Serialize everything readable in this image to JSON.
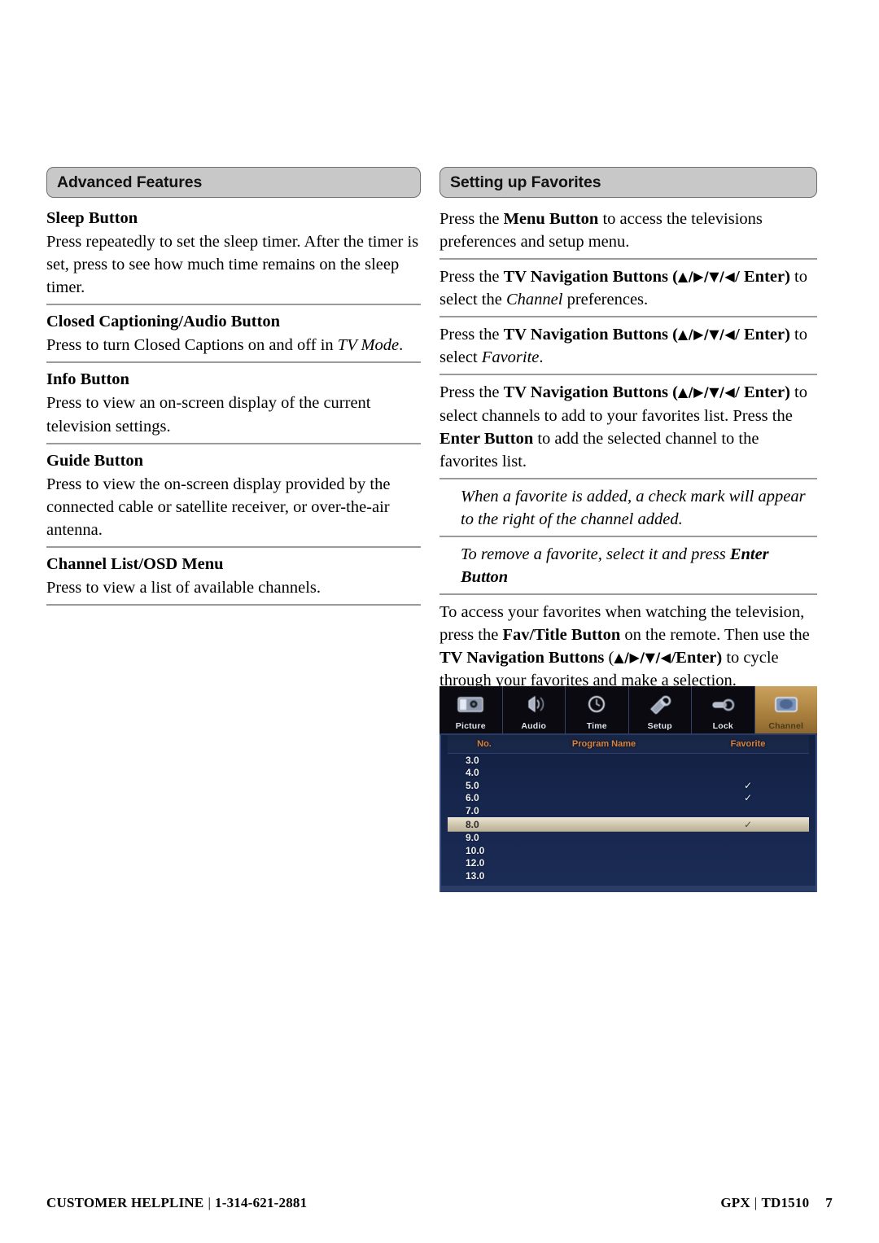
{
  "left_column": {
    "header": "Advanced Features",
    "blocks": [
      {
        "title": "Sleep Button",
        "body": "Press repeatedly to set the sleep timer. After the timer is set, press to see how much time remains on the sleep timer."
      },
      {
        "title": "Closed Captioning/Audio Button",
        "body_pre": "Press to turn Closed Captions on and off in ",
        "body_italic": "TV Mode",
        "body_post": "."
      },
      {
        "title": "Info Button",
        "body": "Press to view an on-screen display of the current television settings."
      },
      {
        "title": "Guide Button",
        "body": "Press to view the on-screen display provided by the connected cable or satellite receiver, or over-the-air antenna."
      },
      {
        "title": "Channel List/OSD Menu",
        "body": "Press to view a list of available channels."
      }
    ]
  },
  "right_column": {
    "header": "Setting up Favorites",
    "blocks": [
      {
        "seg1": "Press the ",
        "bold1": "Menu Button",
        "seg2": " to access the televisions preferences and setup menu."
      },
      {
        "seg1": "Press the ",
        "bold1": "TV Navigation Buttons (",
        "glyphs": "▲/▶/▼/◀",
        "bold2": "/ Enter)",
        "seg2": " to select the ",
        "italic1": "Channel",
        "seg3": " preferences."
      },
      {
        "seg1": "Press the ",
        "bold1": "TV Navigation Buttons (",
        "glyphs": "▲/▶/▼/◀",
        "bold2": "/ Enter)",
        "seg2": " to select ",
        "italic1": "Favorite",
        "seg3": "."
      },
      {
        "seg1": "Press the ",
        "bold1": "TV Navigation Buttons (",
        "glyphs": "▲/▶/▼/◀",
        "bold2": "/ Enter)",
        "seg2": " to select channels to add to your favorites list. Press the ",
        "bold3": "Enter Button",
        "seg3": " to add the selected channel to the favorites list."
      },
      {
        "italic_note": "When a favorite is added, a check mark will appear to the right of the channel added."
      },
      {
        "italic_pre": "To remove a favorite, select it and press ",
        "italic_bold": "Enter Button"
      },
      {
        "seg1": "To access your favorites when watching the television, press the ",
        "bold1": "Fav/Title Button",
        "seg2": " on the remote. Then use the ",
        "bold2": "TV Navigation Buttons",
        "seg3": " (",
        "glyphs": "▲/▶/▼/◀",
        "bold3": "/Enter)",
        "seg4": " to cycle through your favorites and make a selection."
      }
    ]
  },
  "tv_screenshot": {
    "menu_items": [
      {
        "label": "Picture",
        "icon": "picture-icon",
        "active": false
      },
      {
        "label": "Audio",
        "icon": "audio-icon",
        "active": false
      },
      {
        "label": "Time",
        "icon": "time-icon",
        "active": false
      },
      {
        "label": "Setup",
        "icon": "setup-icon",
        "active": false
      },
      {
        "label": "Lock",
        "icon": "lock-icon",
        "active": false
      },
      {
        "label": "Channel",
        "icon": "channel-icon",
        "active": true
      }
    ],
    "columns": [
      "No.",
      "Program Name",
      "Favorite"
    ],
    "rows": [
      {
        "no": "3.0",
        "name": "",
        "favorite": "",
        "selected": false
      },
      {
        "no": "4.0",
        "name": "",
        "favorite": "",
        "selected": false
      },
      {
        "no": "5.0",
        "name": "",
        "favorite": "✓",
        "selected": false
      },
      {
        "no": "6.0",
        "name": "",
        "favorite": "✓",
        "selected": false
      },
      {
        "no": "7.0",
        "name": "",
        "favorite": "",
        "selected": false
      },
      {
        "no": "8.0",
        "name": "",
        "favorite": "✓",
        "selected": true
      },
      {
        "no": "9.0",
        "name": "",
        "favorite": "",
        "selected": false
      },
      {
        "no": "10.0",
        "name": "",
        "favorite": "",
        "selected": false
      },
      {
        "no": "12.0",
        "name": "",
        "favorite": "",
        "selected": false
      },
      {
        "no": "13.0",
        "name": "",
        "favorite": "",
        "selected": false
      }
    ],
    "colors": {
      "highlight": "#c9a25c",
      "header_text": "#d9823c",
      "panel_bg": "#16254b"
    }
  },
  "footer": {
    "helpline_label": "CUSTOMER HELPLINE",
    "separator": "|",
    "phone": "1-314-621-2881",
    "brand": "GPX",
    "model": "TD1510",
    "page_number": "7"
  }
}
